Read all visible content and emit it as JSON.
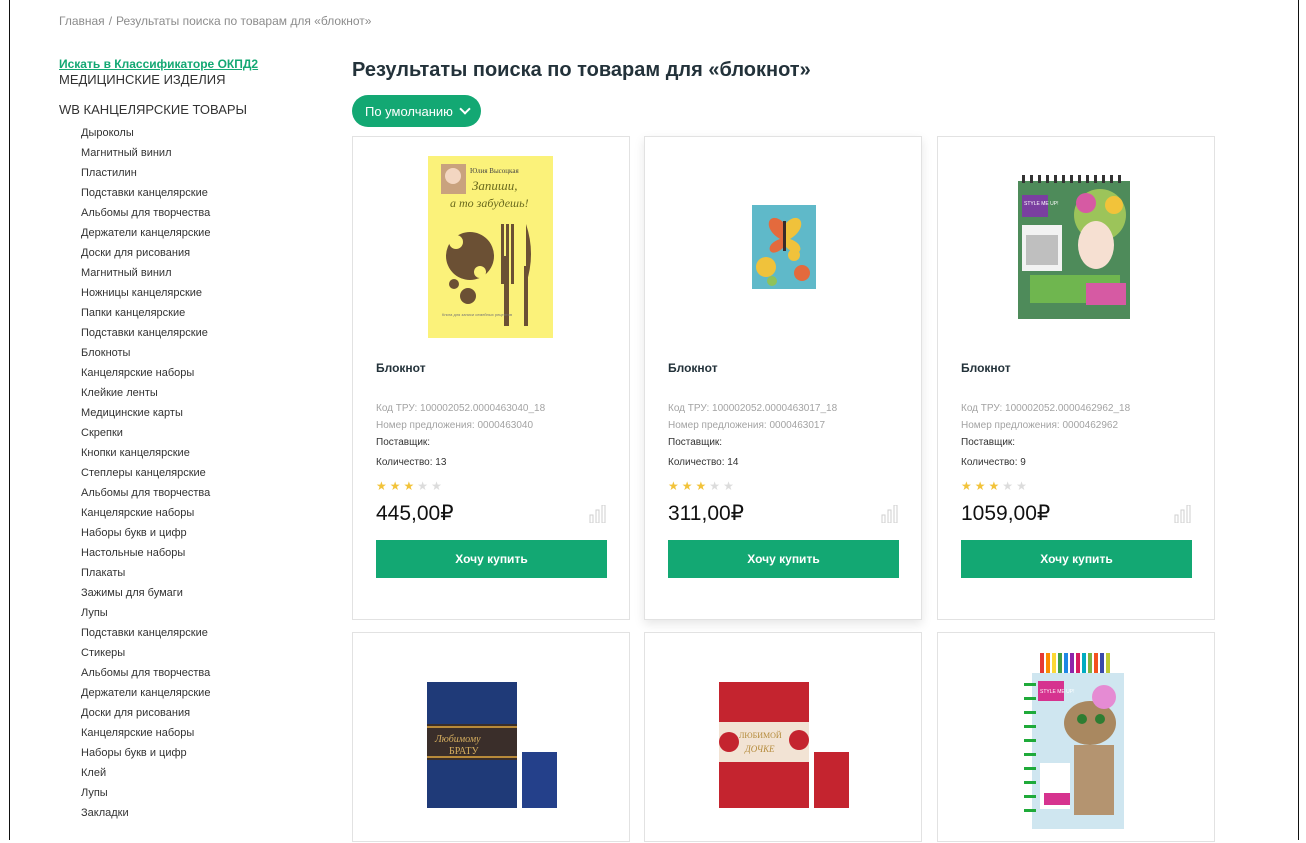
{
  "breadcrumb": {
    "home": "Главная",
    "separator": "/",
    "current": "Результаты поиска по товарам для «блокнот»"
  },
  "sidebar": {
    "okpd_link": "Искать в Классификаторе ОКПД2",
    "section_medical": "МЕДИЦИНСКИЕ ИЗДЕЛИЯ",
    "section_stationery": "WB КАНЦЕЛЯРСКИЕ ТОВАРЫ",
    "categories": [
      "Дыроколы",
      "Магнитный винил",
      "Пластилин",
      "Подставки канцелярские",
      "Альбомы для творчества",
      "Держатели канцелярские",
      "Доски для рисования",
      "Магнитный винил",
      "Ножницы канцелярские",
      "Папки канцелярские",
      "Подставки канцелярские",
      "Блокноты",
      "Канцелярские наборы",
      "Клейкие ленты",
      "Медицинские карты",
      "Скрепки",
      "Кнопки канцелярские",
      "Степлеры канцелярские",
      "Альбомы для творчества",
      "Канцелярские наборы",
      "Наборы букв и цифр",
      "Настольные наборы",
      "Плакаты",
      "Зажимы для бумаги",
      "Лупы",
      "Подставки канцелярские",
      "Стикеры",
      "Альбомы для творчества",
      "Держатели канцелярские",
      "Доски для рисования",
      "Канцелярские наборы",
      "Наборы букв и цифр",
      "Клей",
      "Лупы",
      "Закладки"
    ]
  },
  "main": {
    "title": "Результаты поиска по товарам для «блокнот»",
    "sort_label": "По умолчанию"
  },
  "products": [
    {
      "name": "Блокнот",
      "code": "Код ТРУ: 100002052.0000463040_18",
      "offer": "Номер предложения: 0000463040",
      "supplier": "Поставщик:",
      "quantity": "Количество: 13",
      "rating": 3,
      "price": "445,00₽",
      "buy_label": "Хочу купить",
      "cover_title": "Юлия Высоцкая",
      "cover_line1": "Запиши,",
      "cover_line2": "а то забудешь!",
      "cover_small": "Книга для записи семейных рецептов"
    },
    {
      "name": "Блокнот",
      "code": "Код ТРУ: 100002052.0000463017_18",
      "offer": "Номер предложения: 0000463017",
      "supplier": "Поставщик:",
      "quantity": "Количество: 14",
      "rating": 3,
      "price": "311,00₽",
      "buy_label": "Хочу купить"
    },
    {
      "name": "Блокнот",
      "code": "Код ТРУ: 100002052.0000462962_18",
      "offer": "Номер предложения: 0000462962",
      "supplier": "Поставщик:",
      "quantity": "Количество: 9",
      "rating": 3,
      "price": "1059,00₽",
      "buy_label": "Хочу купить",
      "cover_brand": "STYLE ME UP!"
    },
    {
      "cover_line1": "Любимому",
      "cover_line2": "БРАТУ"
    },
    {
      "cover_line1": "ЛЮБИМОЙ",
      "cover_line2": "ДОЧКЕ"
    },
    {
      "cover_brand": "STYLE ME UP!"
    }
  ],
  "colors": {
    "accent": "#13a873",
    "star_on": "#f2c33a",
    "star_off": "#dcdcdc"
  }
}
